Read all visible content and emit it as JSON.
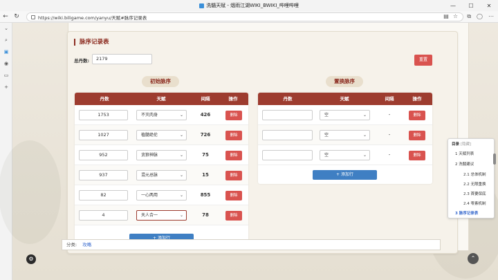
{
  "window": {
    "title": "洗髓天赋 - 烟雨江湖WIKI_BWIKI_哔哩哔哩"
  },
  "browser": {
    "url": "https://wiki.biligame.com/yanyu/天赋#脉序记录表",
    "back_icon": "back-arrow-icon",
    "refresh_icon": "refresh-icon"
  },
  "card": {
    "title": "脉序记录表",
    "total_label": "总丹数:",
    "total_value": "2179",
    "reset_label": "重置"
  },
  "initial": {
    "tag": "初始脉序",
    "headers": {
      "dan": "丹数",
      "talent": "天赋",
      "gap": "间隔",
      "op": "操作"
    },
    "rows": [
      {
        "dan": "1753",
        "talent": "不灭肉身",
        "gap": "426",
        "del": "删除"
      },
      {
        "dan": "1027",
        "talent": "植髓绝伦",
        "gap": "726",
        "del": "删除"
      },
      {
        "dan": "952",
        "talent": "贪狼神脉",
        "gap": "75",
        "del": "删除"
      },
      {
        "dan": "937",
        "talent": "混元总脉",
        "gap": "15",
        "del": "删除"
      },
      {
        "dan": "82",
        "talent": "一心两用",
        "gap": "855",
        "del": "删除"
      },
      {
        "dan": "4",
        "talent": "天人合一",
        "gap": "78",
        "del": "删除"
      }
    ],
    "add_label": "+ 添加行"
  },
  "swap": {
    "tag": "置换脉序",
    "headers": {
      "dan": "丹数",
      "talent": "天赋",
      "gap": "间隔",
      "op": "操作"
    },
    "rows": [
      {
        "dan": "",
        "talent": "空",
        "gap": "-",
        "del": "删除"
      },
      {
        "dan": "",
        "talent": "空",
        "gap": "-",
        "del": "删除"
      },
      {
        "dan": "",
        "talent": "空",
        "gap": "-",
        "del": "删除"
      }
    ],
    "add_label": "+ 添加行"
  },
  "toc": {
    "title": "目录",
    "hide": "[隐藏]",
    "items": [
      {
        "label": "1  天赋列表"
      },
      {
        "label": "2  洗髓建议"
      },
      {
        "label": "2.1  总体机制"
      },
      {
        "label": "2.2  无限重换"
      },
      {
        "label": "2.3  首要保底"
      },
      {
        "label": "2.4  零素机制"
      },
      {
        "label": "3  脉序记录表"
      }
    ]
  },
  "categories": {
    "label": "分类:",
    "link": "攻略"
  }
}
